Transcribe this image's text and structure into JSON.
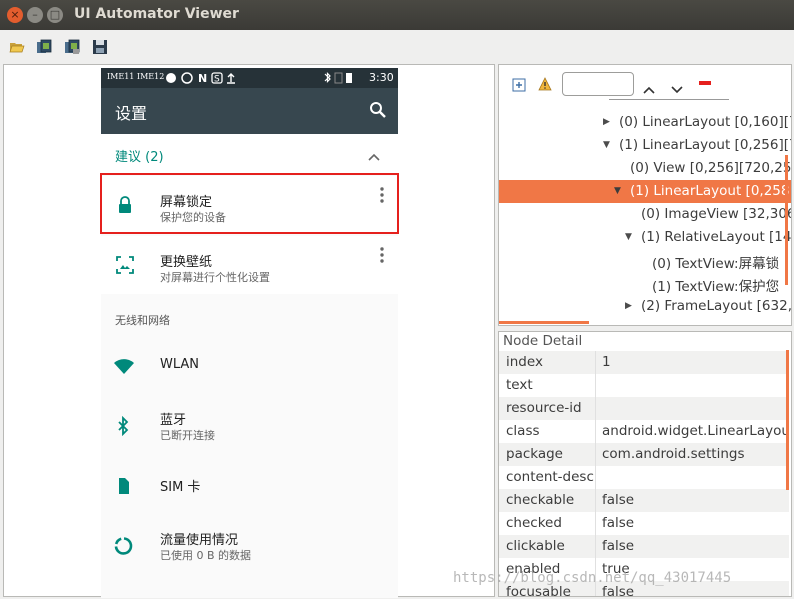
{
  "window": {
    "title": "UI Automator Viewer",
    "close_glyph": "×",
    "min_glyph": "–",
    "max_glyph": "□"
  },
  "toolbar": {
    "icons": [
      "open-folder-icon",
      "device-screenshot-icon",
      "device-screenshot-compressed-icon",
      "save-icon"
    ]
  },
  "phone": {
    "status_left": "IME11 IME12",
    "status_time": "3:30",
    "app_title": "设置",
    "suggestions": {
      "title": "建议 (2)"
    },
    "cards": [
      {
        "title": "屏幕锁定",
        "subtitle": "保护您的设备"
      },
      {
        "title": "更换壁纸",
        "subtitle": "对屏幕进行个性化设置"
      }
    ],
    "section_title": "无线和网络",
    "items": [
      {
        "title": "WLAN",
        "subtitle": ""
      },
      {
        "title": "蓝牙",
        "subtitle": "已断开连接"
      },
      {
        "title": "SIM 卡",
        "subtitle": ""
      },
      {
        "title": "流量使用情况",
        "subtitle": "已使用 0 B 的数据"
      }
    ],
    "accent_color": "#00897b",
    "statusbar_color": "#263238",
    "appbar_color": "#37474f"
  },
  "tree": {
    "rows": [
      {
        "label": "(0) LinearLayout [0,160][7",
        "expander": "▶",
        "selected": false
      },
      {
        "label": "(1) LinearLayout [0,256][7",
        "expander": "▼",
        "selected": false
      },
      {
        "label": "(0) View [0,256][720,25",
        "expander": "",
        "selected": false
      },
      {
        "label": "(1) LinearLayout [0,258",
        "expander": "▼",
        "selected": true
      },
      {
        "label": "(0) ImageView [32,306",
        "expander": "",
        "selected": false
      },
      {
        "label": "(1) RelativeLayout [14",
        "expander": "▼",
        "selected": false
      },
      {
        "label": "(0) TextView:屏幕锁",
        "expander": "",
        "selected": false
      },
      {
        "label": "(1) TextView:保护您",
        "expander": "",
        "selected": false
      },
      {
        "label": "(2) FrameLayout [632,",
        "expander": "▶",
        "selected": false
      }
    ],
    "selection_color": "#f07746"
  },
  "detail": {
    "header": "Node Detail",
    "rows": [
      {
        "key": "index",
        "value": "1"
      },
      {
        "key": "text",
        "value": ""
      },
      {
        "key": "resource-id",
        "value": ""
      },
      {
        "key": "class",
        "value": "android.widget.LinearLayou"
      },
      {
        "key": "package",
        "value": "com.android.settings"
      },
      {
        "key": "content-desc",
        "value": ""
      },
      {
        "key": "checkable",
        "value": "false"
      },
      {
        "key": "checked",
        "value": "false"
      },
      {
        "key": "clickable",
        "value": "false"
      },
      {
        "key": "enabled",
        "value": "true"
      },
      {
        "key": "focusable",
        "value": "false"
      }
    ]
  },
  "watermark": "https://blog.csdn.net/qq_43017445"
}
